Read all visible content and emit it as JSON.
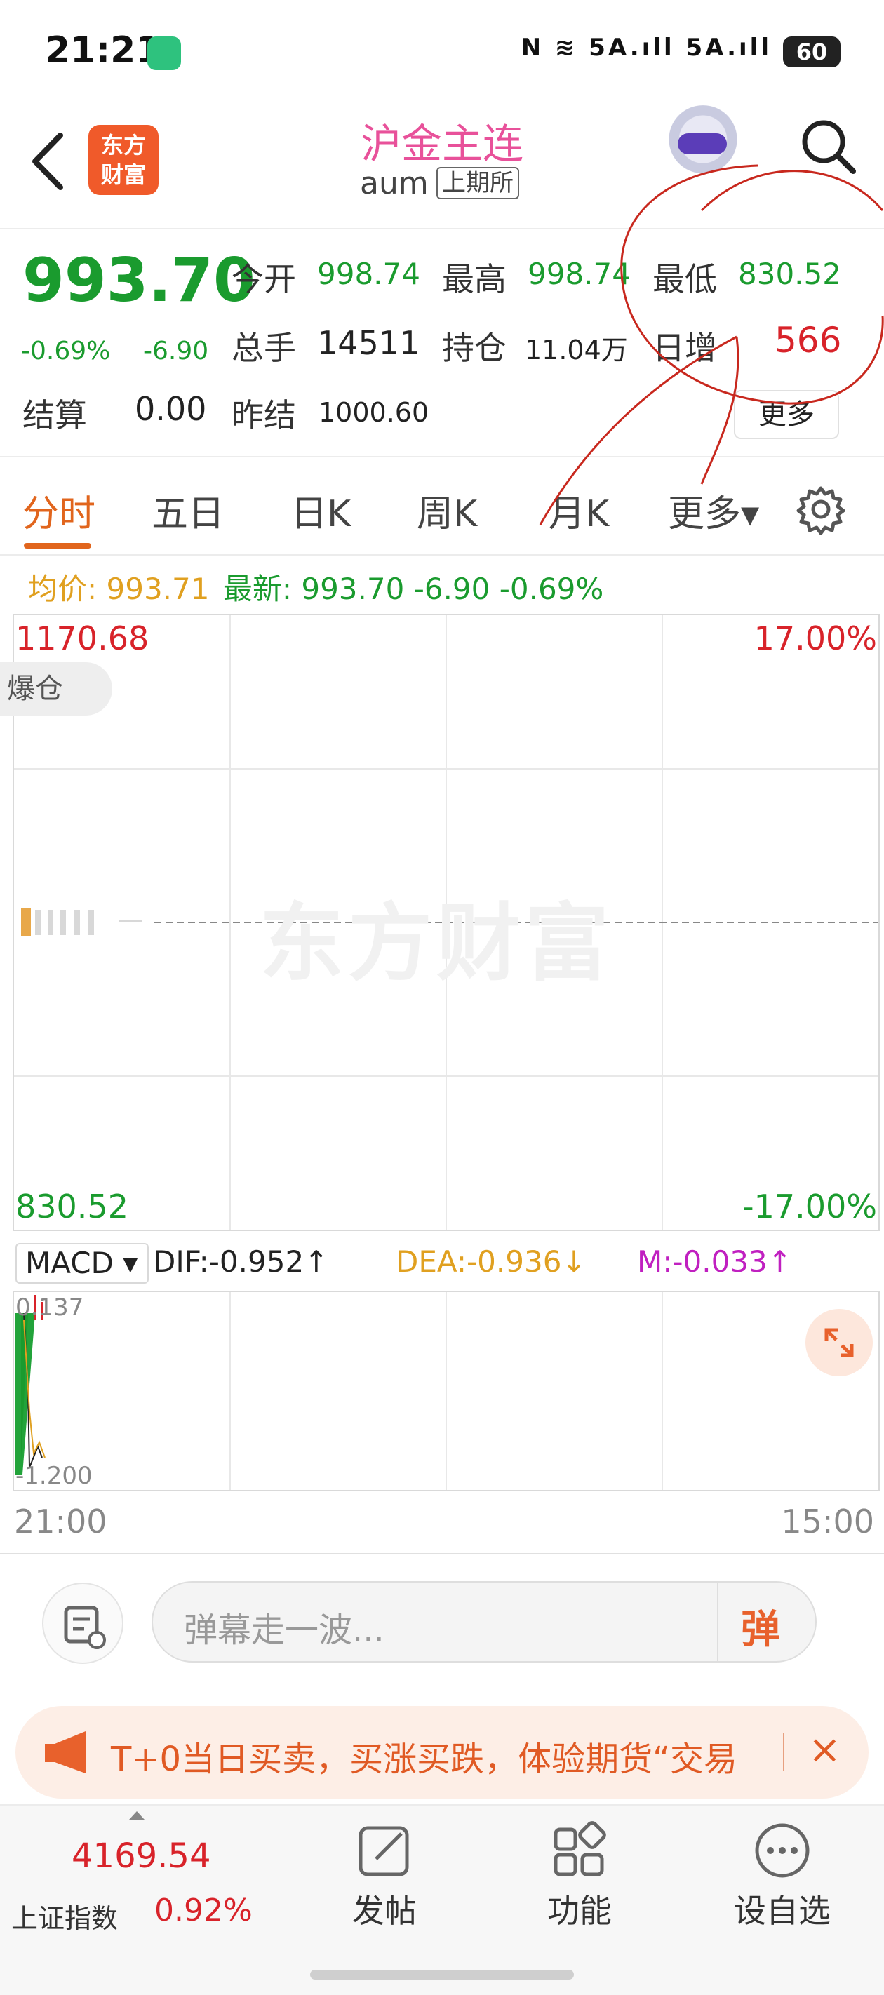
{
  "status_bar": {
    "time": "21:21",
    "network": "N ≋ 5A.ıll 5A.ıll",
    "battery": "60"
  },
  "header": {
    "title": "沪金主连",
    "code": "aum",
    "exchange": "上期所",
    "logo_line1": "东方",
    "logo_line2": "财富"
  },
  "quote": {
    "price": "993.70",
    "change_pct": "-0.69%",
    "change": "-6.90",
    "open_label": "今开",
    "open": "998.74",
    "high_label": "最高",
    "high": "998.74",
    "low_label": "最低",
    "low": "830.52",
    "volume_label": "总手",
    "volume": "14511",
    "oi_label": "持仓",
    "oi": "11.04万",
    "daily_inc_label": "日增",
    "daily_inc": "566",
    "settle_label": "结算",
    "settle": "0.00",
    "prev_settle_label": "昨结",
    "prev_settle": "1000.60",
    "more_label": "更多"
  },
  "tabs": [
    "分时",
    "五日",
    "日K",
    "周K",
    "月K",
    "更多▾"
  ],
  "info_line": {
    "avg_label": "均价:",
    "avg": "993.71",
    "latest_label": "最新:",
    "latest": "993.70",
    "change": "-6.90",
    "pct": "-0.69%"
  },
  "chart": {
    "max": "1170.68",
    "max_pct": "17.00%",
    "min": "830.52",
    "min_pct": "-17.00%",
    "badge": "爆仓",
    "watermark": "东方财富"
  },
  "macd": {
    "selector": "MACD ▾",
    "dif": "DIF:-0.952↑",
    "dea": "DEA:-0.936↓",
    "m": "M:-0.033↑",
    "top": "0.137",
    "bottom": "-1.200"
  },
  "time_axis": {
    "start": "21:00",
    "end": "15:00"
  },
  "danmu": {
    "placeholder": "弹幕走一波...",
    "send": "弹"
  },
  "promo": {
    "text": "T+0当日买卖，买涨买跌，体验期货“交易",
    "close": "×"
  },
  "bottom_bar": {
    "index_value": "4169.54",
    "index_name": "上证指数",
    "index_pct": "0.92%",
    "post": "发帖",
    "features": "功能",
    "watchlist": "设自选"
  },
  "colors": {
    "up": "#d8232a",
    "down": "#1a9b2e",
    "accent": "#e1651d",
    "avg": "#e0a020",
    "macd_m": "#c020c0"
  }
}
